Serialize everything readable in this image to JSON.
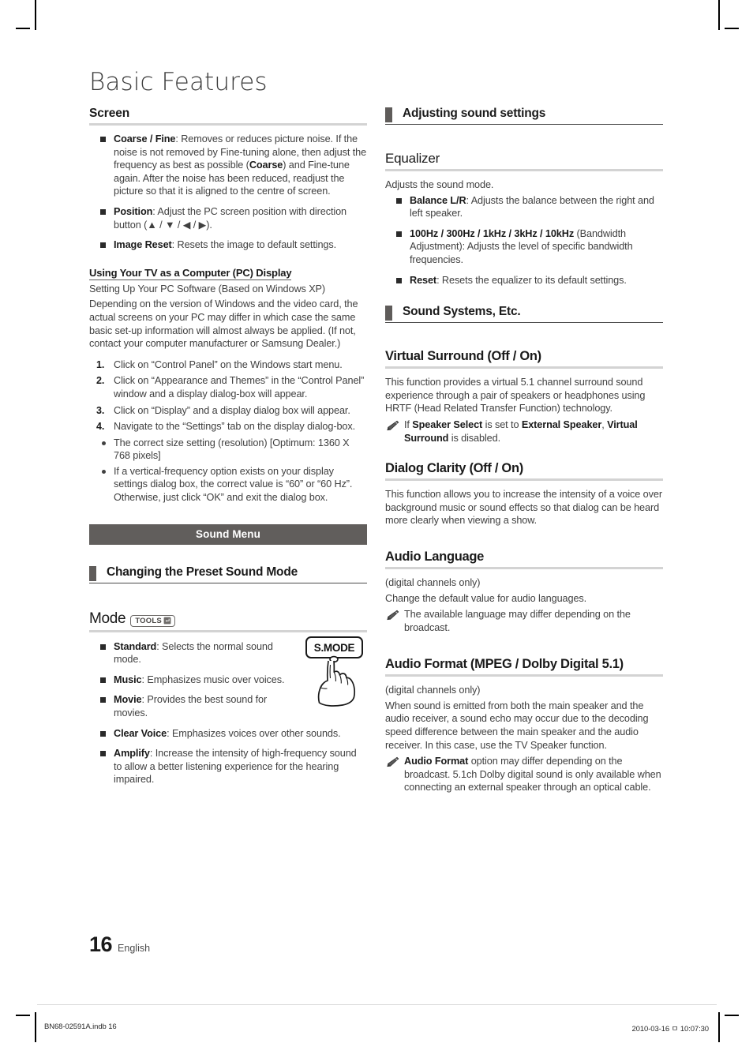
{
  "document": {
    "title": "Basic Features",
    "page_number": "16",
    "language": "English",
    "footer_left": "BN68-02591A.indb   16",
    "footer_right": "2010-03-16   ㅁ 10:07:30"
  },
  "left_column": {
    "screen": {
      "heading": "Screen",
      "bullets": [
        {
          "term": "Coarse / Fine",
          "sep": ": ",
          "text_pre": "Removes or reduces picture noise. If the noise is not removed by Fine-tuning alone, then adjust the frequency as best as possible (",
          "emphasis": "Coarse",
          "text_post": ") and Fine-tune again. After the noise has been reduced, readjust the picture so that it is aligned to the centre of screen."
        },
        {
          "term": "Position",
          "sep": ": ",
          "text": "Adjust the PC screen position with direction button (▲ / ▼ / ◀ / ▶)."
        },
        {
          "term": "Image Reset",
          "sep": ": ",
          "text": "Resets the image to default settings."
        }
      ]
    },
    "pc_display": {
      "subheading": "Using Your TV as a Computer (PC) Display",
      "intro_line": "Setting Up Your PC Software (Based on Windows XP)",
      "intro_paragraph": "Depending on the version of Windows and the video card, the actual screens on your PC may differ in which case the same basic set-up information will almost always be applied. (If not, contact your computer manufacturer or Samsung Dealer.)",
      "steps": [
        "Click on “Control Panel” on the Windows start menu.",
        "Click on “Appearance and Themes” in the “Control Panel” window and a display dialog-box will appear.",
        "Click on “Display” and a display dialog box will appear.",
        "Navigate to the “Settings” tab on the display dialog-box."
      ],
      "notes": [
        "The correct size setting (resolution) [Optimum: 1360 X 768 pixels]",
        "If a vertical-frequency option exists on your display settings dialog box, the correct value is “60” or “60 Hz”. Otherwise, just click “OK” and exit the dialog box."
      ]
    },
    "sound_menu_banner": "Sound Menu",
    "preset_section": {
      "heading": "Changing the Preset Sound Mode"
    },
    "mode": {
      "heading": "Mode",
      "tools_label": "TOOLS",
      "remote_key_label": "S.MODE",
      "bullets": [
        {
          "term": "Standard",
          "sep": ": ",
          "text": "Selects the normal sound mode."
        },
        {
          "term": "Music",
          "sep": ": ",
          "text": "Emphasizes music over voices."
        },
        {
          "term": "Movie",
          "sep": ": ",
          "text": "Provides the best sound for movies."
        },
        {
          "term": "Clear Voice",
          "sep": ": ",
          "text": "Emphasizes voices over other sounds."
        },
        {
          "term": "Amplify",
          "sep": ": ",
          "text": "Increase the intensity of high-frequency sound to allow a better listening experience for the hearing impaired."
        }
      ]
    }
  },
  "right_column": {
    "adjusting_section": {
      "heading": "Adjusting sound settings"
    },
    "equalizer": {
      "heading": "Equalizer",
      "intro": "Adjusts the sound mode.",
      "bullets": [
        {
          "term": "Balance L/R",
          "sep": ": ",
          "text": "Adjusts the balance between the right and left speaker."
        },
        {
          "term": "100Hz / 300Hz / 1kHz / 3kHz / 10kHz",
          "sep": " ",
          "text": "(Bandwidth Adjustment): Adjusts the level of specific bandwidth frequencies."
        },
        {
          "term": "Reset",
          "sep": ": ",
          "text": "Resets the equalizer to its default settings."
        }
      ]
    },
    "sound_systems_section": {
      "heading": "Sound Systems, Etc."
    },
    "virtual_surround": {
      "heading": "Virtual Surround (Off / On)",
      "paragraph": "This function provides a virtual 5.1 channel surround sound experience through a pair of speakers or headphones using HRTF (Head Related Transfer Function) technology.",
      "note_pre": "If ",
      "note_b1": "Speaker Select",
      "note_mid1": " is set to ",
      "note_b2": "External Speaker",
      "note_mid2": ", ",
      "note_b3": "Virtual Surround",
      "note_post": " is disabled."
    },
    "dialog_clarity": {
      "heading": "Dialog Clarity (Off / On)",
      "paragraph": "This function allows you to increase the intensity of a voice over background music or sound effects so that dialog can be heard more clearly when viewing a show."
    },
    "audio_language": {
      "heading": "Audio Language",
      "sub": "(digital channels only)",
      "paragraph": "Change the default value for audio languages.",
      "note": "The available language may differ depending on the broadcast."
    },
    "audio_format": {
      "heading": "Audio Format (MPEG / Dolby Digital 5.1)",
      "sub": "(digital channels only)",
      "paragraph": "When sound is emitted from both the main speaker and the audio receiver, a sound echo may occur due to the decoding speed difference between the main speaker and the audio receiver. In this case, use the TV Speaker function.",
      "note_b": "Audio Format",
      "note_text": " option may differ depending on the broadcast. 5.1ch Dolby digital sound is only available when connecting an external speaker through an optical cable."
    }
  },
  "colors": {
    "banner_bg": "#615e5c",
    "section_bar": "#5f5c5a",
    "rule_light": "#d3d3d3",
    "body_text": "#404040",
    "heading_text": "#1a1a1a"
  }
}
